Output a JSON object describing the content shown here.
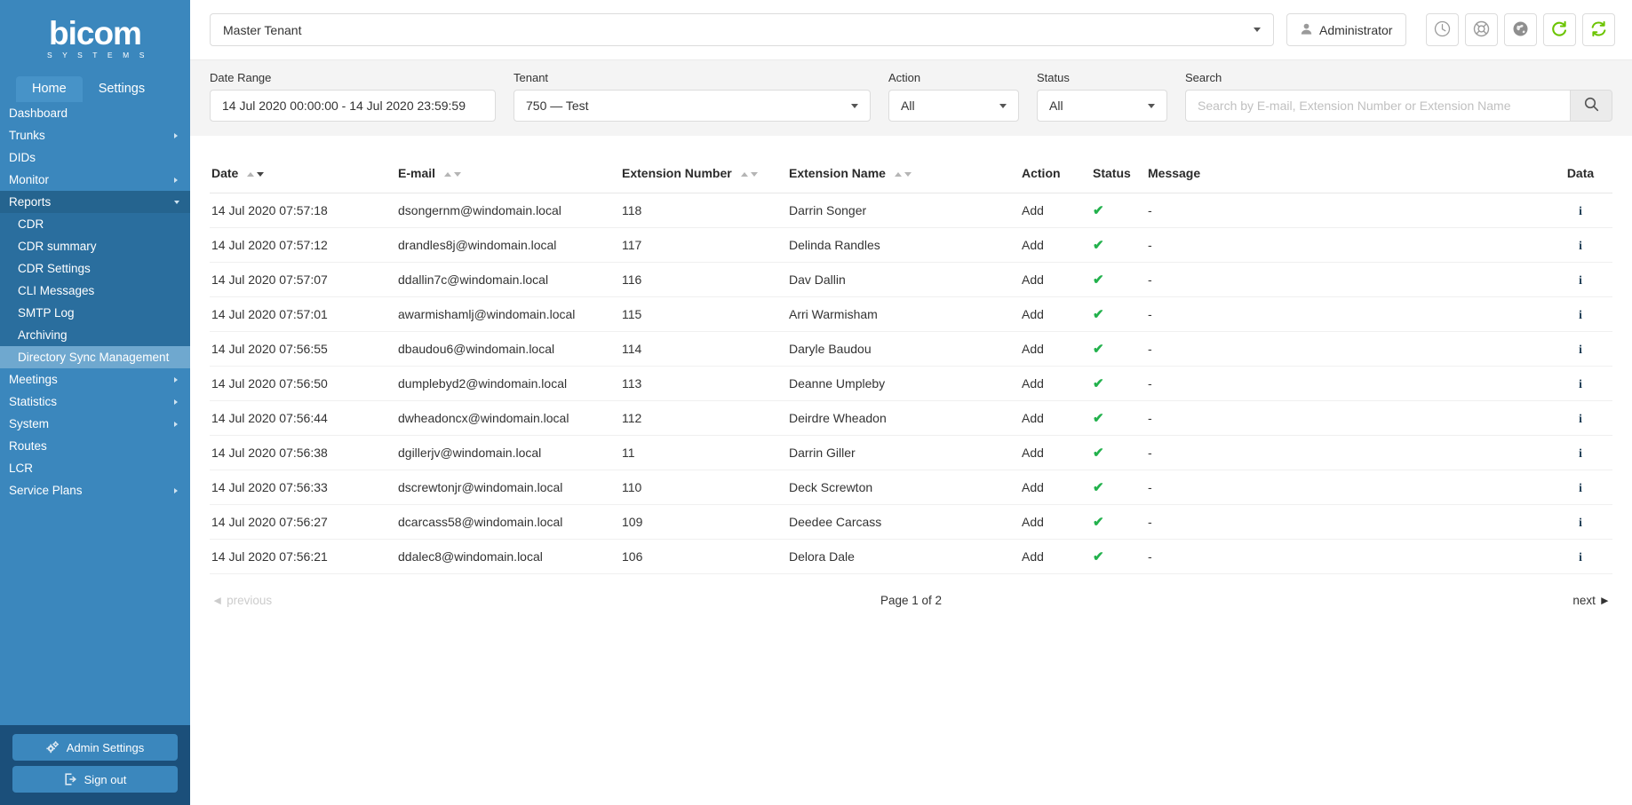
{
  "brand": {
    "name": "bicom",
    "tagline": "S Y S T E M S"
  },
  "sidebar": {
    "tabs": [
      {
        "label": "Home",
        "active": true
      },
      {
        "label": "Settings",
        "active": false
      }
    ],
    "nav": [
      {
        "label": "Dashboard",
        "caret": "none"
      },
      {
        "label": "Trunks",
        "caret": "right"
      },
      {
        "label": "DIDs",
        "caret": "none"
      },
      {
        "label": "Monitor",
        "caret": "right"
      },
      {
        "label": "Reports",
        "caret": "down",
        "expanded": true
      }
    ],
    "subnav": [
      {
        "label": "CDR",
        "active": false
      },
      {
        "label": "CDR summary",
        "active": false
      },
      {
        "label": "CDR Settings",
        "active": false
      },
      {
        "label": "CLI Messages",
        "active": false
      },
      {
        "label": "SMTP Log",
        "active": false
      },
      {
        "label": "Archiving",
        "active": false
      },
      {
        "label": "Directory Sync Management",
        "active": true
      }
    ],
    "nav_after": [
      {
        "label": "Meetings",
        "caret": "right"
      },
      {
        "label": "Statistics",
        "caret": "right"
      },
      {
        "label": "System",
        "caret": "right"
      },
      {
        "label": "Routes",
        "caret": "none"
      },
      {
        "label": "LCR",
        "caret": "none"
      },
      {
        "label": "Service Plans",
        "caret": "right"
      }
    ],
    "admin_settings_label": "Admin Settings",
    "sign_out_label": "Sign out"
  },
  "topbar": {
    "tenant_value": "Master Tenant",
    "admin_label": "Administrator",
    "icons": [
      {
        "name": "clock-icon"
      },
      {
        "name": "lifebuoy-icon"
      },
      {
        "name": "globe-icon"
      },
      {
        "name": "refresh-icon"
      },
      {
        "name": "sync-icon"
      }
    ]
  },
  "filters": {
    "date_range": {
      "label": "Date Range",
      "value": "14 Jul 2020 00:00:00 - 14 Jul 2020 23:59:59"
    },
    "tenant": {
      "label": "Tenant",
      "value": "750  — Test"
    },
    "action": {
      "label": "Action",
      "value": "All"
    },
    "status": {
      "label": "Status",
      "value": "All"
    },
    "search": {
      "label": "Search",
      "value": "",
      "placeholder": "Search by E-mail, Extension Number or Extension Name"
    }
  },
  "table": {
    "columns": [
      {
        "key": "date",
        "label": "Date",
        "sorted": "desc"
      },
      {
        "key": "email",
        "label": "E-mail",
        "sorted": "none"
      },
      {
        "key": "extnum",
        "label": "Extension Number",
        "sorted": "none"
      },
      {
        "key": "extname",
        "label": "Extension Name",
        "sorted": "none"
      },
      {
        "key": "action",
        "label": "Action",
        "sorted": null
      },
      {
        "key": "status",
        "label": "Status",
        "sorted": null
      },
      {
        "key": "message",
        "label": "Message",
        "sorted": null
      },
      {
        "key": "data",
        "label": "Data",
        "sorted": null
      }
    ],
    "rows": [
      {
        "date": "14 Jul 2020 07:57:18",
        "email": "dsongernm@windomain.local",
        "extnum": "118",
        "extname": "Darrin Songer",
        "action": "Add",
        "status": "ok",
        "message": "-",
        "data": "info-icon"
      },
      {
        "date": "14 Jul 2020 07:57:12",
        "email": "drandles8j@windomain.local",
        "extnum": "117",
        "extname": "Delinda Randles",
        "action": "Add",
        "status": "ok",
        "message": "-",
        "data": "info-icon"
      },
      {
        "date": "14 Jul 2020 07:57:07",
        "email": "ddallin7c@windomain.local",
        "extnum": "116",
        "extname": "Dav Dallin",
        "action": "Add",
        "status": "ok",
        "message": "-",
        "data": "info-icon"
      },
      {
        "date": "14 Jul 2020 07:57:01",
        "email": "awarmishamlj@windomain.local",
        "extnum": "115",
        "extname": "Arri Warmisham",
        "action": "Add",
        "status": "ok",
        "message": "-",
        "data": "info-icon"
      },
      {
        "date": "14 Jul 2020 07:56:55",
        "email": "dbaudou6@windomain.local",
        "extnum": "114",
        "extname": "Daryle Baudou",
        "action": "Add",
        "status": "ok",
        "message": "-",
        "data": "info-icon"
      },
      {
        "date": "14 Jul 2020 07:56:50",
        "email": "dumplebyd2@windomain.local",
        "extnum": "113",
        "extname": "Deanne Umpleby",
        "action": "Add",
        "status": "ok",
        "message": "-",
        "data": "info-icon"
      },
      {
        "date": "14 Jul 2020 07:56:44",
        "email": "dwheadoncx@windomain.local",
        "extnum": "112",
        "extname": "Deirdre Wheadon",
        "action": "Add",
        "status": "ok",
        "message": "-",
        "data": "info-icon"
      },
      {
        "date": "14 Jul 2020 07:56:38",
        "email": "dgillerjv@windomain.local",
        "extnum": "11",
        "extname": "Darrin Giller",
        "action": "Add",
        "status": "ok",
        "message": "-",
        "data": "info-icon"
      },
      {
        "date": "14 Jul 2020 07:56:33",
        "email": "dscrewtonjr@windomain.local",
        "extnum": "110",
        "extname": "Deck Screwton",
        "action": "Add",
        "status": "ok",
        "message": "-",
        "data": "info-icon"
      },
      {
        "date": "14 Jul 2020 07:56:27",
        "email": "dcarcass58@windomain.local",
        "extnum": "109",
        "extname": "Deedee Carcass",
        "action": "Add",
        "status": "ok",
        "message": "-",
        "data": "info-icon"
      },
      {
        "date": "14 Jul 2020 07:56:21",
        "email": "ddalec8@windomain.local",
        "extnum": "106",
        "extname": "Delora Dale",
        "action": "Add",
        "status": "ok",
        "message": "-",
        "data": "info-icon"
      }
    ]
  },
  "pagination": {
    "previous": "previous",
    "page_info": "Page 1 of 2",
    "next": "next"
  },
  "colors": {
    "sidebar": "#3b87bd",
    "sidebar_dark": "#1b4f7a",
    "submenu": "#2a6e9e",
    "submenu_active": "#6fa8cf",
    "expanded": "#25648f",
    "status_green": "#22b14c",
    "filter_bg": "#f4f4f4"
  }
}
